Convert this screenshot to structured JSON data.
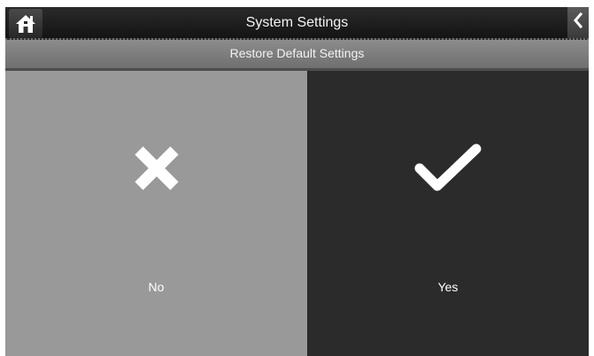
{
  "header": {
    "title": "System Settings",
    "home_icon": "home-icon",
    "back_icon": "chevron-left-icon"
  },
  "subheader": {
    "title": "Restore Default Settings"
  },
  "options": {
    "no": {
      "label": "No",
      "icon": "close-x-icon",
      "background": "#999999"
    },
    "yes": {
      "label": "Yes",
      "icon": "checkmark-icon",
      "background": "#2b2b2b"
    }
  },
  "colors": {
    "titlebar": "#1c1c1c",
    "subheader": "#7d7d7d",
    "icon": "#ffffff"
  }
}
